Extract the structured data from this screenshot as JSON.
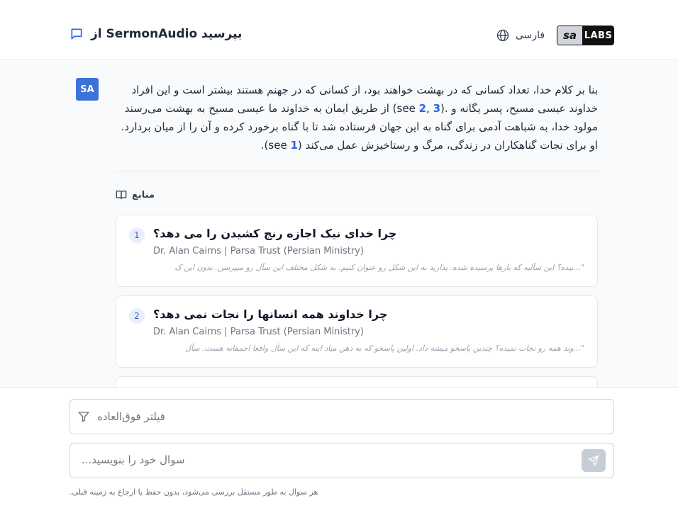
{
  "header": {
    "title": "بپرسید SermonAudio از",
    "language_label": "فارسی",
    "logo_sa": "sa",
    "logo_labs": "LABS"
  },
  "answer": {
    "avatar": "SA",
    "line1": "بنا بر کلام خدا، تعداد کسانی که در بهشت خواهند بود، از کسانی که در جهنم هستند بیشتر است و این افراد",
    "line2_pre": "خداوند عیسی مسیح، پسر یگانه و .(see",
    "ref_a": "2",
    "ref_sep": ", ",
    "ref_b": "3",
    "line2_post": ") از طریق ایمان به خداوند ما عیسی مسیح به بهشت می‌رسند",
    "line3": "مولود خدا، به شباهت آدمی برای گناه به این جهان فرستاده شد تا با گناه برخورد کرده و آن را از میان بردارد.",
    "line4_pre": "او برای نجات گناهکاران در زندگی، مرگ و رستاخیزش عمل می‌کند (see",
    "ref_c": "1",
    "line4_post": ")."
  },
  "sources": {
    "label": "منابع",
    "items": [
      {
        "num": "1",
        "title": "چرا خدای نیک اجازه رنج کشیدن را می دهد؟",
        "author": "Dr. Alan Cairns | Parsa Trust (Persian Ministry)",
        "excerpt": "\"...بیده؟ این سآلیه که بارها پرسیده شده. بذارید به این شکل رو عنوان کنیم. به شکل مختلف این سآل رو میپرسن. بدون این ک"
      },
      {
        "num": "2",
        "title": "چرا خداوند همه انسانها را نجات نمی دهد؟",
        "author": "Dr. Alan Cairns | Parsa Trust (Persian Ministry)",
        "excerpt": "\"...وند همه رو نجات نمیده؟ چندین پاسخو میشه داد. اولین پاسخو که به ذهن میاد اینه که این سآل واقعا احمقانه هست. سآل"
      }
    ]
  },
  "footer": {
    "filter_placeholder": "فیلتر فوق‌العاده",
    "ask_placeholder": "سوال خود را بنویسید...",
    "note": "هر سوال به طور مستقل بررسی می‌شود، بدون حفظ یا ارجاع به زمینه قبلی."
  },
  "colors": {
    "accent": "#3b74d6",
    "link": "#2563eb"
  }
}
